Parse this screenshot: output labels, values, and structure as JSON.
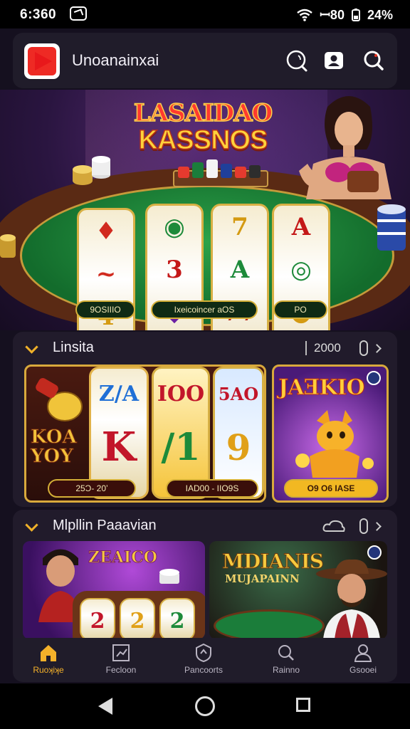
{
  "status_bar": {
    "time": "6:360",
    "signal_text": "ꟷ80",
    "battery": "24%"
  },
  "header": {
    "app_name": "Unoanainxai",
    "icons": [
      "chat-search-icon",
      "account-icon",
      "search-icon"
    ]
  },
  "hero": {
    "title_line1": "LASAIDAO",
    "title_line2": "KASSNOS",
    "labels": [
      "9OSIIIO",
      "Ixeicoincer aOS",
      "PO"
    ]
  },
  "section1": {
    "title": "Linsita",
    "counter": "2000",
    "cards": [
      {
        "tag": "25Ɔ- 20ʼ",
        "reel_texts": [
          "Z/A",
          "K"
        ],
        "side_text": "KOA YOY"
      },
      {
        "tag": "IAD00 - IIO9S",
        "reel_texts": [
          "IOO",
          "5AO",
          "/1",
          "9"
        ]
      },
      {
        "tag": "O9 O6 IASE",
        "title": "JAƎKIO"
      }
    ]
  },
  "section2": {
    "title": "Mlpllin Paaavian",
    "cards": [
      {
        "title": "ZEAICO"
      },
      {
        "title": "MDIANIS",
        "subtitle": "MUJAPAINN"
      }
    ]
  },
  "bottom_nav": [
    {
      "label": "Ruoʞiʞe",
      "icon": "home-icon",
      "active": true
    },
    {
      "label": "Fecloon",
      "icon": "chart-icon",
      "active": false
    },
    {
      "label": "Pancoorts",
      "icon": "shield-icon",
      "active": false
    },
    {
      "label": "Rainno",
      "icon": "search-icon",
      "active": false
    },
    {
      "label": "Gsooei",
      "icon": "profile-icon",
      "active": false
    }
  ],
  "colors": {
    "accent": "#f4b12a",
    "brand_red": "#ee2a24",
    "felt_green": "#1f8a3a",
    "panel": "#211b2b"
  }
}
